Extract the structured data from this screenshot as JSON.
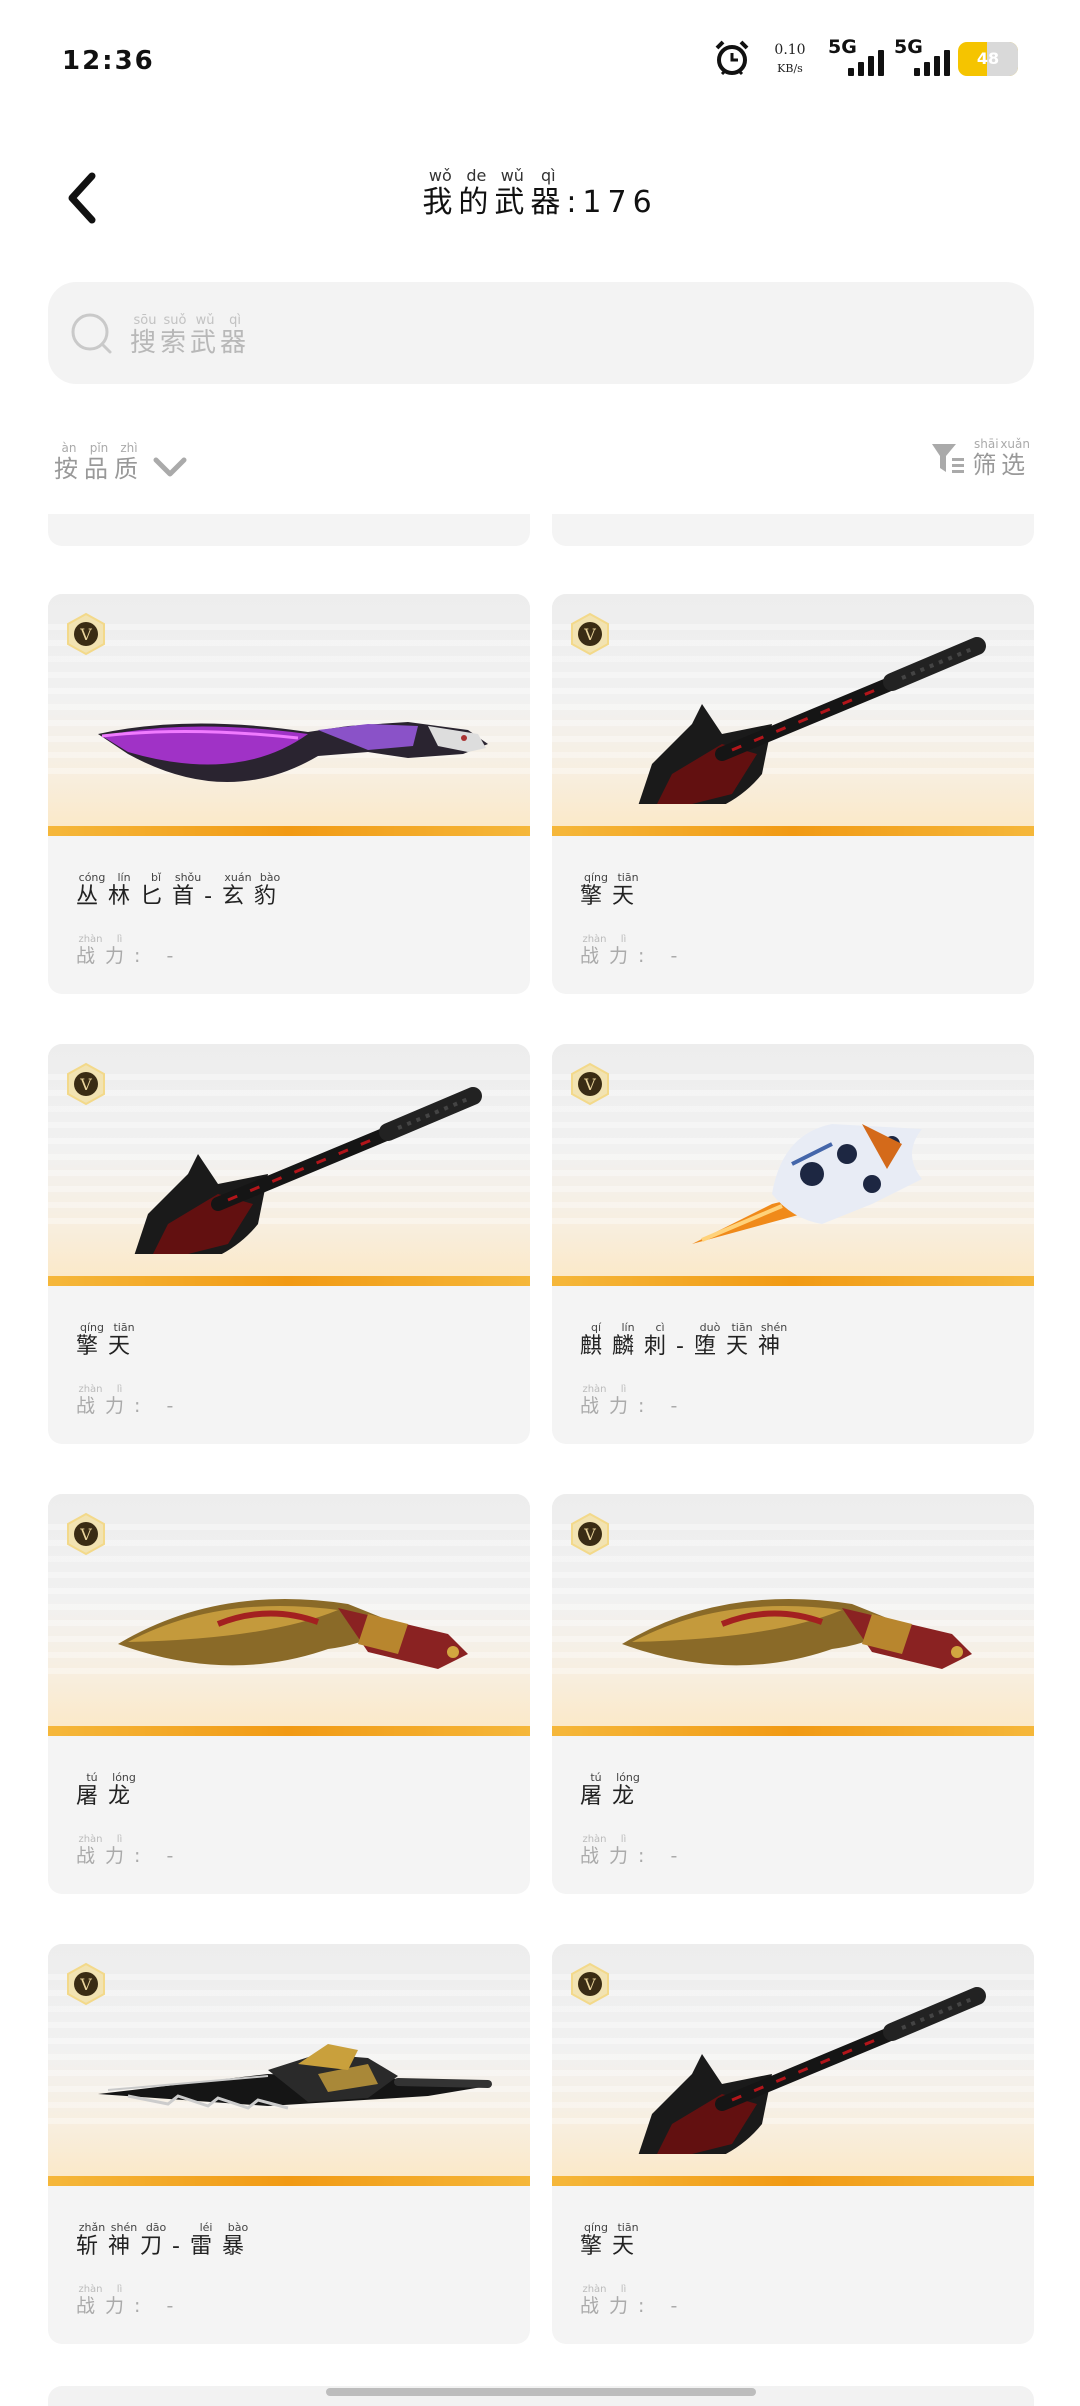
{
  "status": {
    "time": "12:36",
    "net_speed_value": "0.10",
    "net_speed_unit": "KB/s",
    "sim1": "5G",
    "sim2": "5G",
    "battery": "48",
    "battery_level": 0.48,
    "icons": [
      "alarm-icon",
      "signal-icon",
      "battery-icon"
    ]
  },
  "header": {
    "back_icon": "chevron-left-icon",
    "title": [
      {
        "ch": "我",
        "py": "wǒ"
      },
      {
        "ch": "的",
        "py": "de"
      },
      {
        "ch": "武",
        "py": "wǔ"
      },
      {
        "ch": "器",
        "py": "qì"
      }
    ],
    "count": ":176"
  },
  "search": {
    "icon": "search-icon",
    "placeholder": [
      {
        "ch": "搜",
        "py": "sōu"
      },
      {
        "ch": "索",
        "py": "suǒ"
      },
      {
        "ch": "武",
        "py": "wǔ"
      },
      {
        "ch": "器",
        "py": "qì"
      }
    ]
  },
  "sort": {
    "label": [
      {
        "ch": "按",
        "py": "àn"
      },
      {
        "ch": "品",
        "py": "pǐn"
      },
      {
        "ch": "质",
        "py": "zhì"
      }
    ],
    "icon": "chevron-down-icon"
  },
  "filter": {
    "icon": "funnel-icon",
    "label": [
      {
        "ch": "筛",
        "py": "shāi"
      },
      {
        "ch": "选",
        "py": "xuǎn"
      }
    ]
  },
  "power_label": [
    {
      "ch": "战",
      "py": "zhàn"
    },
    {
      "ch": "力",
      "py": "lì"
    }
  ],
  "power_suffix": ": -",
  "badge_letter": "V",
  "colors": {
    "accent": "#f19a14",
    "battery": "#f5c400",
    "card_bg": "#f4f4f4"
  },
  "weapons": [
    {
      "kind": "panther-knife",
      "name": [
        {
          "ch": "丛",
          "py": "cóng"
        },
        {
          "ch": "林",
          "py": "lín"
        },
        {
          "ch": "匕",
          "py": "bǐ"
        },
        {
          "ch": "首",
          "py": "shǒu"
        },
        {
          "ch": "-",
          "py": ""
        },
        {
          "ch": "玄",
          "py": "xuán"
        },
        {
          "ch": "豹",
          "py": "bào"
        }
      ]
    },
    {
      "kind": "shovel",
      "name": [
        {
          "ch": "擎",
          "py": "qíng"
        },
        {
          "ch": "天",
          "py": "tiān"
        }
      ]
    },
    {
      "kind": "shovel",
      "name": [
        {
          "ch": "擎",
          "py": "qíng"
        },
        {
          "ch": "天",
          "py": "tiān"
        }
      ]
    },
    {
      "kind": "qilin-dagger",
      "name": [
        {
          "ch": "麒",
          "py": "qí"
        },
        {
          "ch": "麟",
          "py": "lín"
        },
        {
          "ch": "刺",
          "py": "cì"
        },
        {
          "ch": "-",
          "py": ""
        },
        {
          "ch": "堕",
          "py": "duò"
        },
        {
          "ch": "天",
          "py": "tiān"
        },
        {
          "ch": "神",
          "py": "shén"
        }
      ]
    },
    {
      "kind": "kukri",
      "name": [
        {
          "ch": "屠",
          "py": "tú"
        },
        {
          "ch": "龙",
          "py": "lóng"
        }
      ]
    },
    {
      "kind": "kukri",
      "name": [
        {
          "ch": "屠",
          "py": "tú"
        },
        {
          "ch": "龙",
          "py": "lóng"
        }
      ]
    },
    {
      "kind": "thunder-blade",
      "name": [
        {
          "ch": "斩",
          "py": "zhǎn"
        },
        {
          "ch": "神",
          "py": "shén"
        },
        {
          "ch": "刀",
          "py": "dāo"
        },
        {
          "ch": "-",
          "py": ""
        },
        {
          "ch": "雷",
          "py": "léi"
        },
        {
          "ch": "暴",
          "py": "bào"
        }
      ]
    },
    {
      "kind": "shovel",
      "name": [
        {
          "ch": "擎",
          "py": "qíng"
        },
        {
          "ch": "天",
          "py": "tiān"
        }
      ]
    }
  ]
}
